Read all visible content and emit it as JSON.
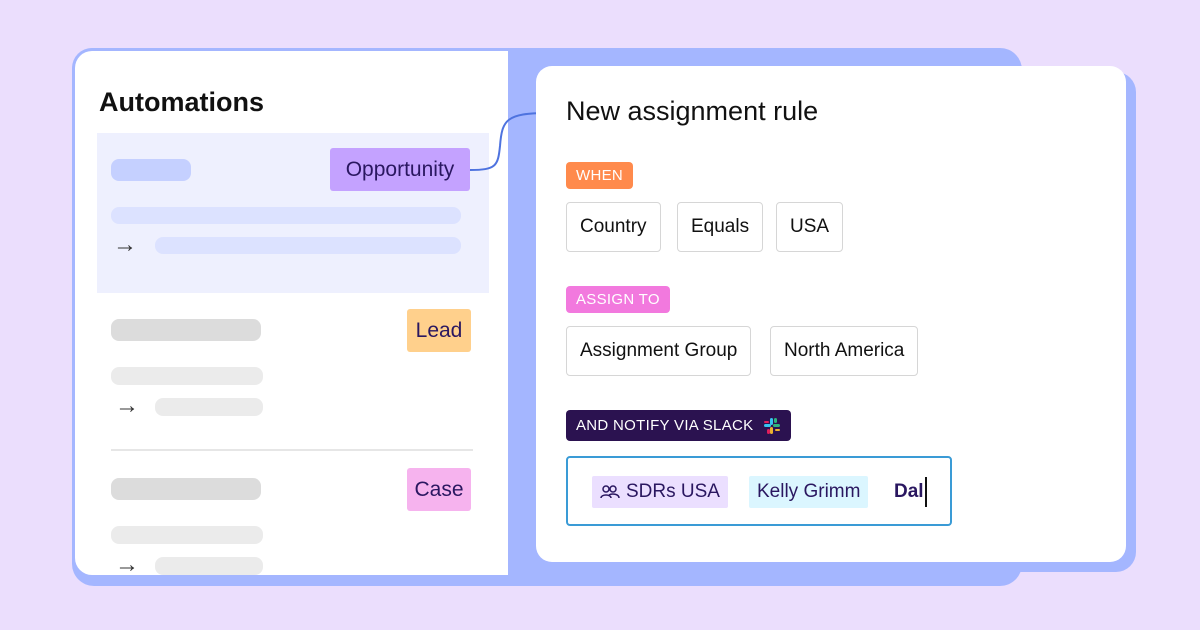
{
  "left_panel": {
    "title": "Automations",
    "items": [
      {
        "tag": "Opportunity",
        "tag_color": "#c4a2ff",
        "active": true
      },
      {
        "tag": "Lead",
        "tag_color": "#ffd08c",
        "active": false
      },
      {
        "tag": "Case",
        "tag_color": "#f6b3ee",
        "active": false
      }
    ]
  },
  "right_panel": {
    "title": "New assignment rule",
    "when": {
      "label": "WHEN",
      "label_color": "#ff8a4c",
      "chips": [
        "Country",
        "Equals",
        "USA"
      ]
    },
    "assign": {
      "label": "ASSIGN TO",
      "label_color": "#f279de",
      "chips": [
        "Assignment Group",
        "North America"
      ]
    },
    "notify": {
      "label": "AND NOTIFY VIA SLACK",
      "label_color": "#2b1250",
      "recipients": [
        {
          "text": "SDRs USA",
          "icon": "group-icon",
          "bg": "#ebdfff"
        },
        {
          "text": "Kelly Grimm",
          "icon": "",
          "bg": "#dbf6ff"
        }
      ],
      "typed_text": "Dal"
    }
  },
  "colors": {
    "background": "#ebdefd",
    "frame": "#a4b6ff",
    "input_border": "#3a9bd6"
  }
}
